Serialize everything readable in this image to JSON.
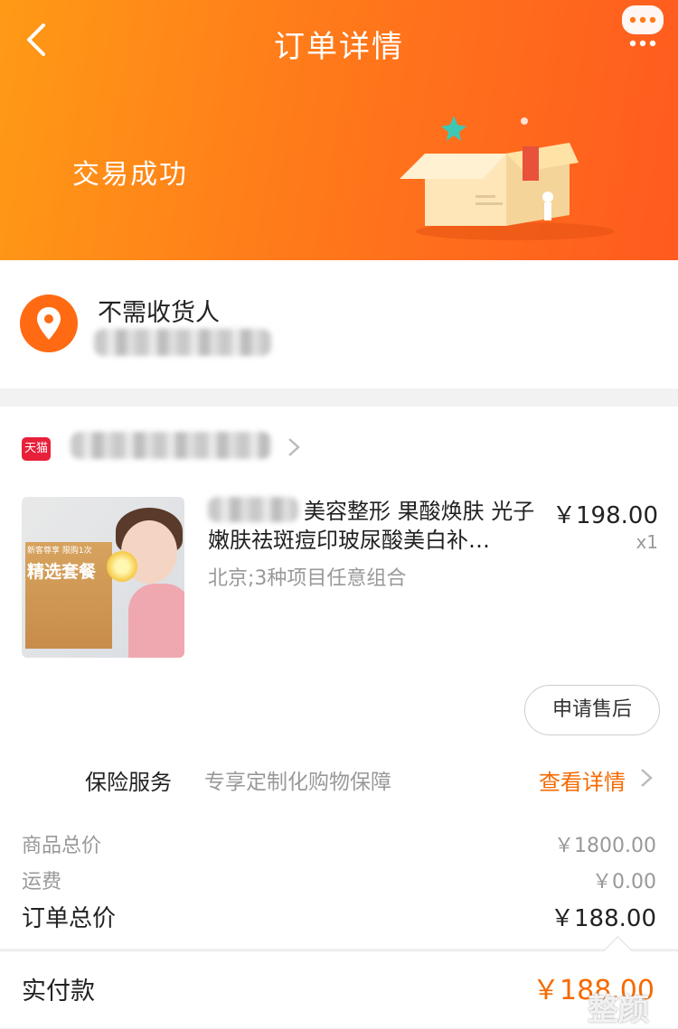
{
  "header": {
    "title": "订单详情",
    "status": "交易成功",
    "colors": {
      "start": "#ff9a16",
      "end": "#ff5a1f"
    }
  },
  "address": {
    "name": "不需收货人"
  },
  "shop": {
    "badge": "天猫"
  },
  "product": {
    "title": "美容整形 果酸焕肤 光子嫩肤祛斑痘印玻尿酸美白补…",
    "spec": "北京;3种项目任意组合",
    "price": "￥198.00",
    "quantity": "x1",
    "thumb_tag": "新客尊享 限购1次",
    "thumb_title": "精选套餐"
  },
  "actions": {
    "after_sale": "申请售后"
  },
  "insurance": {
    "label": "保险服务",
    "desc": "专享定制化购物保障",
    "link": "查看详情"
  },
  "summary": {
    "goods_label": "商品总价",
    "goods_value": "￥1800.00",
    "shipping_label": "运费",
    "shipping_value": "￥0.00",
    "order_label": "订单总价",
    "order_value": "￥188.00"
  },
  "payment": {
    "label": "实付款",
    "value": "￥188.00",
    "accent": "#f56a00"
  },
  "watermark": "整颜"
}
